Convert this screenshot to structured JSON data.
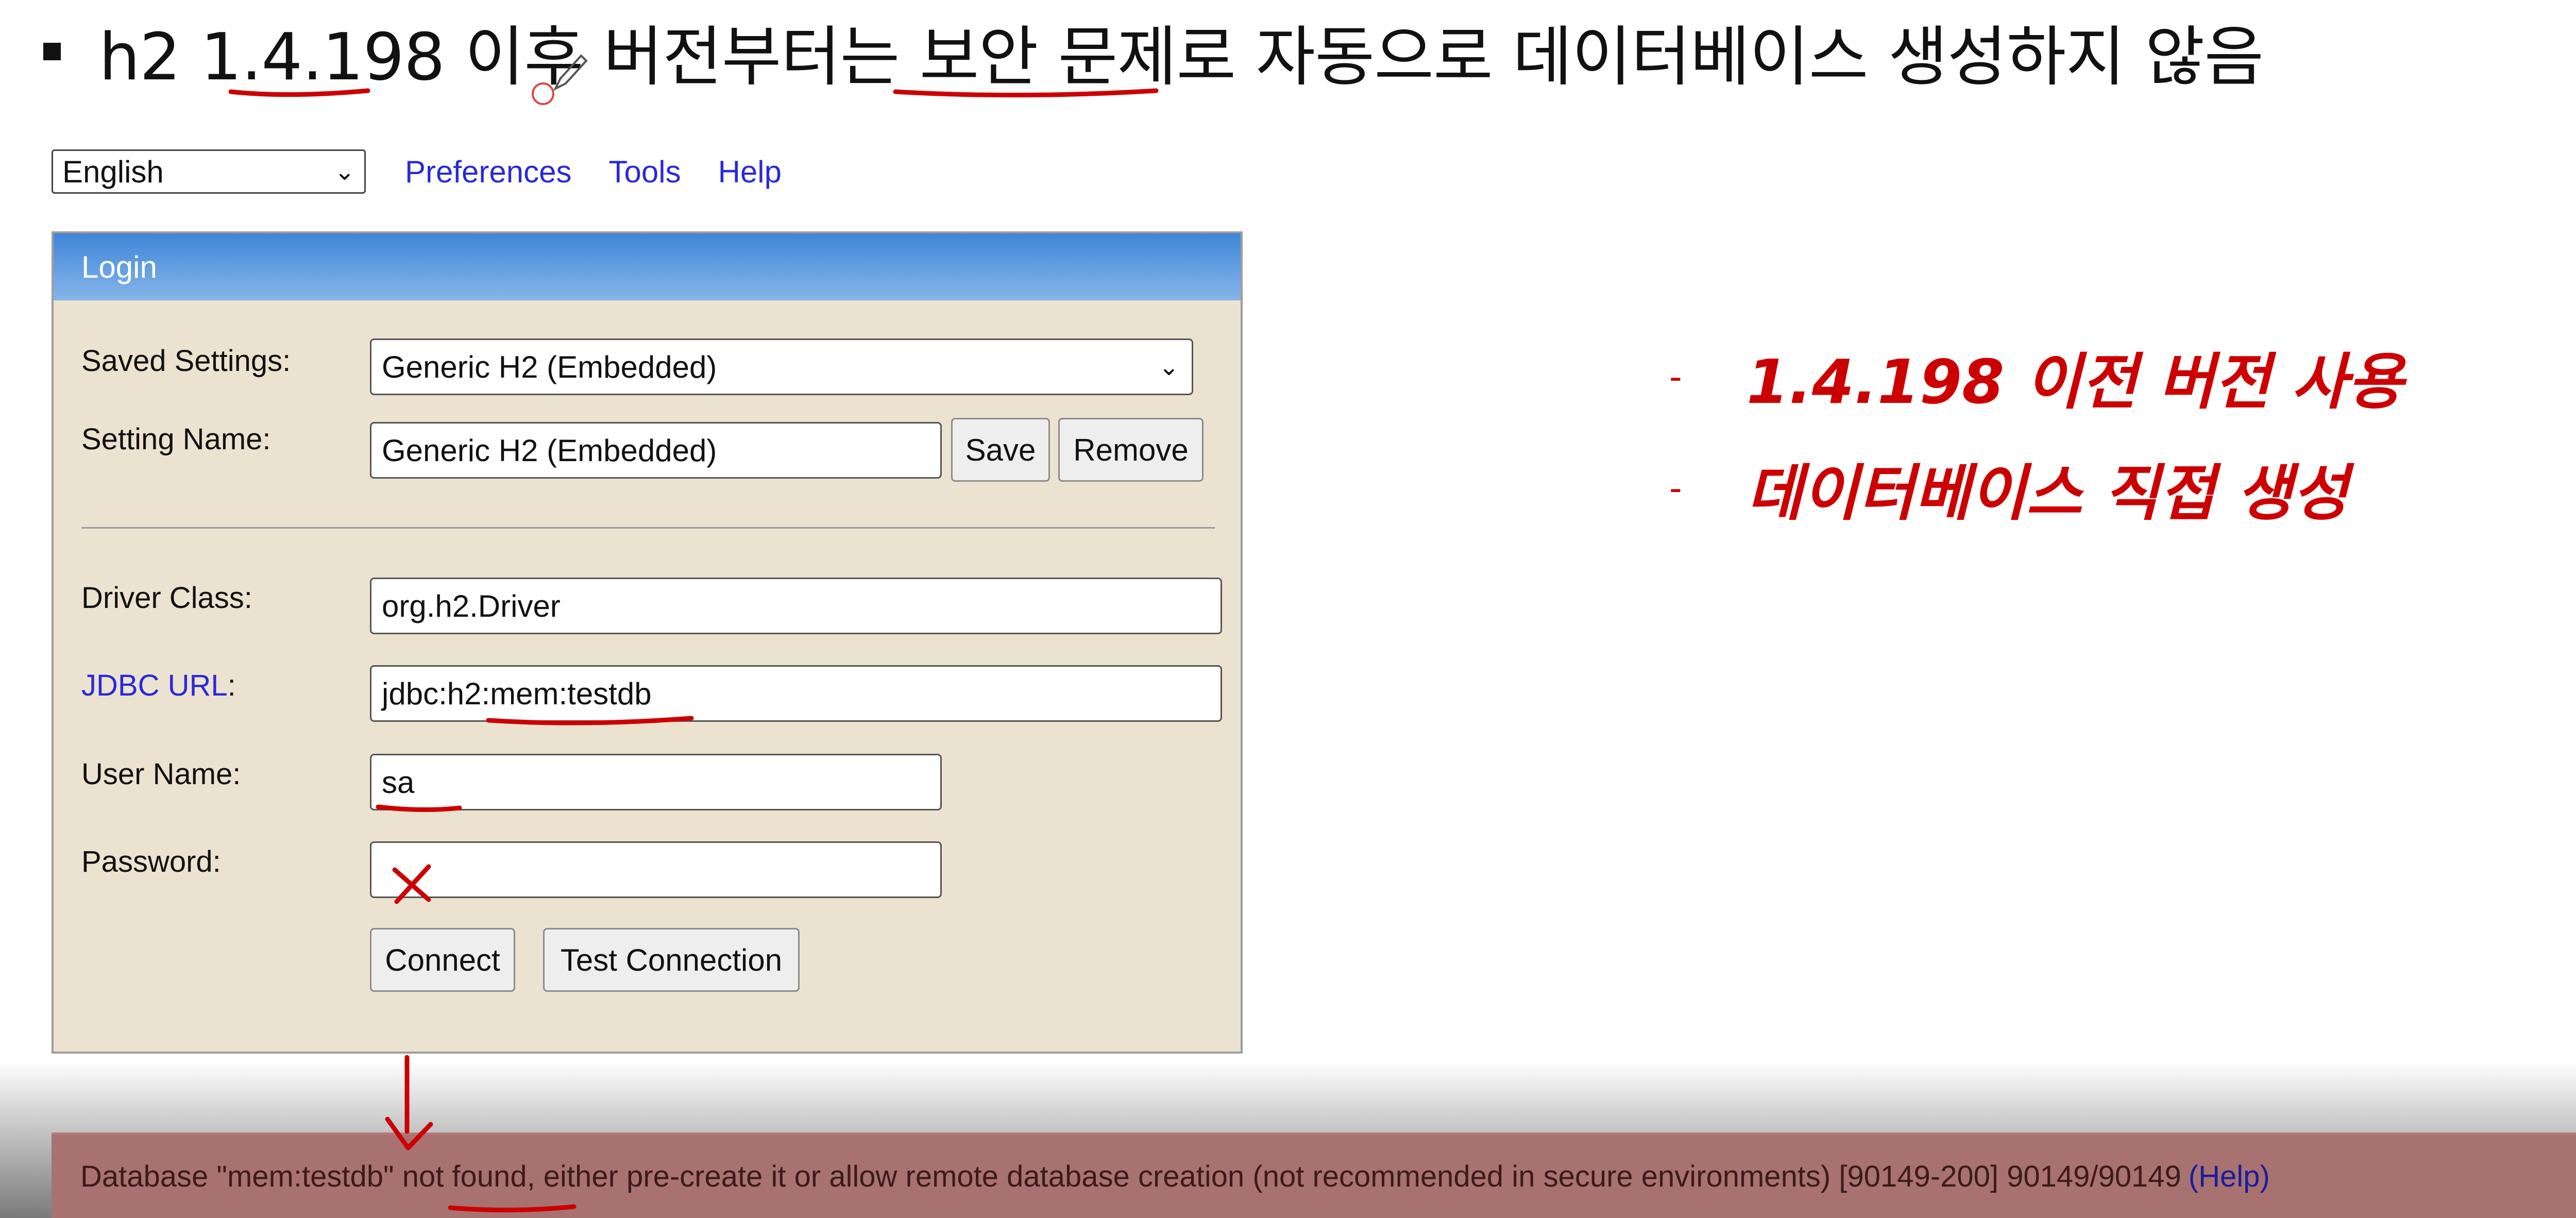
{
  "slide": {
    "title": "h2 1.4.198 이후 버전부터는 보안 문제로 자동으로 데이터베이스 생성하지 않음"
  },
  "top_nav": {
    "language": "English",
    "links": [
      "Preferences",
      "Tools",
      "Help"
    ]
  },
  "login": {
    "header": "Login",
    "saved_settings_label": "Saved Settings:",
    "saved_settings_value": "Generic H2 (Embedded)",
    "setting_name_label": "Setting Name:",
    "setting_name_value": "Generic H2 (Embedded)",
    "save_button": "Save",
    "remove_button": "Remove",
    "driver_class_label": "Driver Class:",
    "driver_class_value": "org.h2.Driver",
    "jdbc_url_label": "JDBC URL",
    "jdbc_url_colon": ":",
    "jdbc_url_value": "jdbc:h2:mem:testdb",
    "user_name_label": "User Name:",
    "user_name_value": "sa",
    "password_label": "Password:",
    "password_value": "",
    "connect_button": "Connect",
    "test_connection_button": "Test Connection"
  },
  "notes": [
    {
      "dash": "-",
      "text": "1.4.198 이전 버전 사용"
    },
    {
      "dash": "-",
      "text": "데이터베이스 직접 생성"
    }
  ],
  "error": {
    "message": "Database \"mem:testdb\" not found, either pre-create it or allow remote database creation (not recommended in secure environments) [90149-200] 90149/90149",
    "help_link": "(Help)"
  },
  "colors": {
    "annotation_red": "#cc0000",
    "link_blue": "#2a2ad6",
    "panel_bg": "#ebe3d0",
    "header_blue": "#3f86d8",
    "error_bg": "#a87270"
  }
}
